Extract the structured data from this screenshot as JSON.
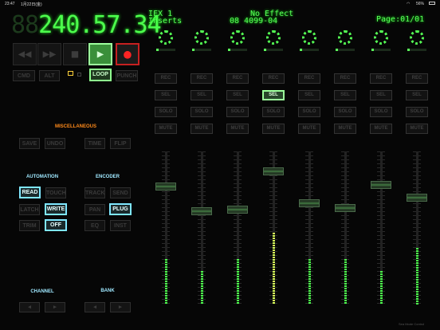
{
  "status_bar": {
    "time": "23:47",
    "date": "1月22日(金)",
    "battery": "56%"
  },
  "timecode": {
    "dim_prefix": "88",
    "digits": "240.57.34",
    "dim_suffix": ""
  },
  "transport": {
    "rewind": "◀◀",
    "forward": "▶▶",
    "stop": "■",
    "play": "▶",
    "record": "●"
  },
  "modifiers": {
    "cmd": "CMD",
    "alt": "ALT",
    "loop": "LOOP",
    "punch": "PUNCH"
  },
  "misc": {
    "title": "MISCELLANEOUS",
    "save": "SAVE",
    "undo": "UNDO",
    "time": "TIME",
    "flip": "FLIP"
  },
  "automation": {
    "title": "AUTOMATION",
    "read": "READ",
    "touch": "TOUCH",
    "latch": "LATCH",
    "write": "WRITE",
    "trim": "TRIM",
    "off": "OFF"
  },
  "encoder": {
    "title": "ENCODER",
    "track": "TRACK",
    "send": "SEND",
    "pan": "PAN",
    "plug": "PLUG",
    "eq": "EQ",
    "inst": "INST"
  },
  "channel": {
    "title": "CHANNEL",
    "left": "◀",
    "right": "▶"
  },
  "bank": {
    "title": "BANK",
    "left": "◀",
    "right": "▶"
  },
  "lcd": {
    "line1_left": "IFX 1",
    "line1_mid": "No Effect",
    "line2_left": "Inserts",
    "line2_mid": "08 4099-04",
    "page": "Page:01/01"
  },
  "strip_buttons": {
    "rec": "REC",
    "sel": "SEL",
    "solo": "SOLO",
    "mute": "MUTE"
  },
  "channels": [
    {
      "fader": 0.77,
      "meter": 0.38,
      "sel": false
    },
    {
      "fader": 0.61,
      "meter": 0.28,
      "sel": false
    },
    {
      "fader": 0.62,
      "meter": 0.38,
      "sel": false
    },
    {
      "fader": 0.87,
      "meter": 0.6,
      "sel": true
    },
    {
      "fader": 0.66,
      "meter": 0.38,
      "sel": false
    },
    {
      "fader": 0.63,
      "meter": 0.38,
      "sel": false
    },
    {
      "fader": 0.78,
      "meter": 0.28,
      "sel": false
    },
    {
      "fader": 0.7,
      "meter": 0.47,
      "sel": false
    }
  ],
  "footer": {
    "brand": "Sea Mode Control"
  },
  "colors": {
    "lcd_green": "#58ff58",
    "accent_cyan": "#7fe7ff",
    "misc_orange": "#ff8a1a",
    "section_cyan": "#9fe8ff",
    "record_red": "#ff2424"
  }
}
